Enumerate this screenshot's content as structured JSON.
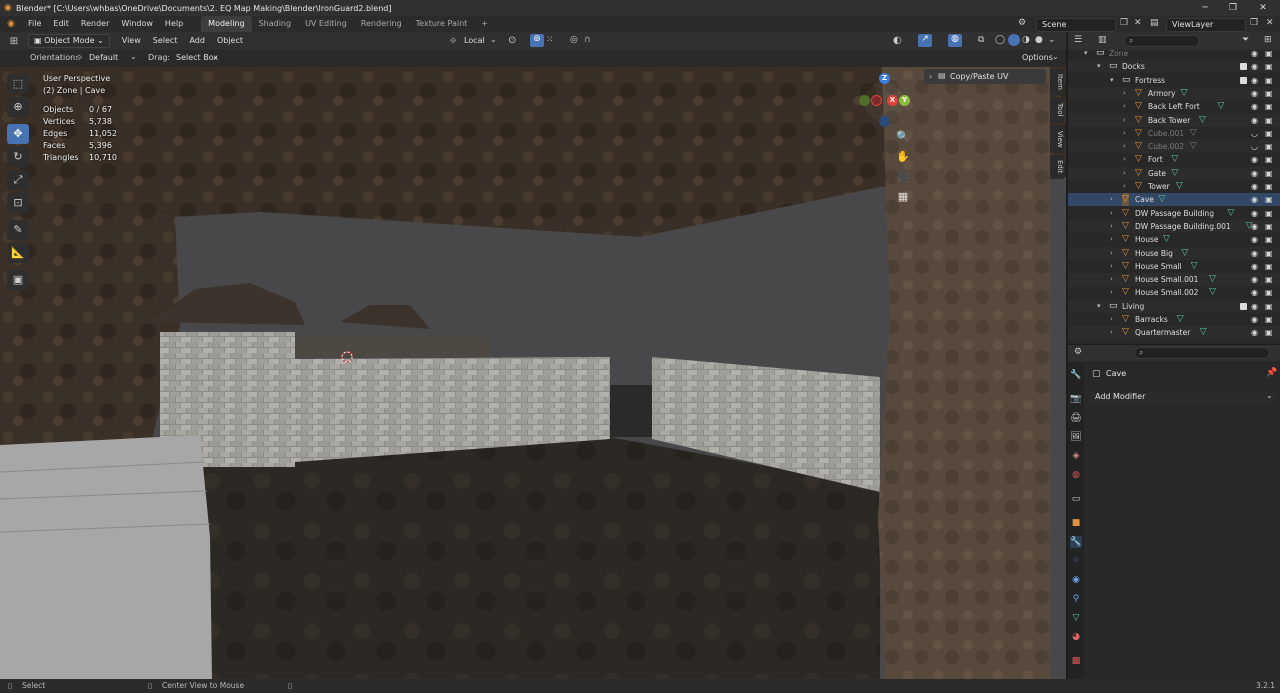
{
  "window": {
    "title": "Blender* [C:\\Users\\whbas\\OneDrive\\Documents\\2. EQ Map Making\\Blender\\IronGuard2.blend]",
    "min": "─",
    "max": "❐",
    "close": "✕"
  },
  "menu": [
    "File",
    "Edit",
    "Render",
    "Window",
    "Help"
  ],
  "workspaces": [
    "Modeling",
    "Shading",
    "UV Editing",
    "Rendering",
    "Texture Paint"
  ],
  "workspace_add": "+",
  "scene": {
    "label": "Scene"
  },
  "view_layer": {
    "label": "ViewLayer"
  },
  "viewport_header": {
    "mode": "Object Mode",
    "items": [
      "View",
      "Select",
      "Add",
      "Object"
    ],
    "transform_orientation": "Local"
  },
  "tool_settings": {
    "orientation_label": "Orientation:",
    "orientation_value": "Default",
    "drag_label": "Drag:",
    "drag_value": "Select Box",
    "options": "Options"
  },
  "overlay": {
    "view_name": "User Perspective",
    "collection": "(2) Zone | Cave",
    "stats": [
      {
        "label": "Objects",
        "value": "0 / 67"
      },
      {
        "label": "Vertices",
        "value": "5,738"
      },
      {
        "label": "Edges",
        "value": "11,052"
      },
      {
        "label": "Faces",
        "value": "5,396"
      },
      {
        "label": "Triangles",
        "value": "10,710"
      }
    ]
  },
  "gizmo": {
    "x": "X",
    "y": "Y",
    "z": "Z"
  },
  "npanel": {
    "tabs": [
      "Item",
      "Tool",
      "View",
      "Edit"
    ],
    "panel_title": "Copy/Paste UV"
  },
  "outliner": {
    "rows": [
      {
        "label": "Zone",
        "indent": 0,
        "icon": "collection",
        "dim": true
      },
      {
        "label": "Docks",
        "indent": 1,
        "icon": "collection"
      },
      {
        "label": "Fortress",
        "indent": 2,
        "icon": "collection"
      },
      {
        "label": "Armory",
        "indent": 3,
        "icon": "object"
      },
      {
        "label": "Back Left Fort",
        "indent": 3,
        "icon": "object"
      },
      {
        "label": "Back Tower",
        "indent": 3,
        "icon": "object"
      },
      {
        "label": "Cube.001",
        "indent": 3,
        "icon": "object",
        "dim": true
      },
      {
        "label": "Cube.002",
        "indent": 3,
        "icon": "object",
        "dim": true
      },
      {
        "label": "Fort",
        "indent": 3,
        "icon": "object"
      },
      {
        "label": "Gate",
        "indent": 3,
        "icon": "object"
      },
      {
        "label": "Tower",
        "indent": 3,
        "icon": "object"
      },
      {
        "label": "Cave",
        "indent": 2,
        "icon": "object",
        "active": true
      },
      {
        "label": "DW Passage Building",
        "indent": 2,
        "icon": "object"
      },
      {
        "label": "DW Passage Building.001",
        "indent": 2,
        "icon": "object"
      },
      {
        "label": "House",
        "indent": 2,
        "icon": "object"
      },
      {
        "label": "House Big",
        "indent": 2,
        "icon": "object"
      },
      {
        "label": "House Small",
        "indent": 2,
        "icon": "object"
      },
      {
        "label": "House Small.001",
        "indent": 2,
        "icon": "object"
      },
      {
        "label": "House Small.002",
        "indent": 2,
        "icon": "object"
      },
      {
        "label": "Living",
        "indent": 1,
        "icon": "collection"
      },
      {
        "label": "Barracks",
        "indent": 2,
        "icon": "object"
      },
      {
        "label": "Quartermaster",
        "indent": 2,
        "icon": "object"
      }
    ]
  },
  "properties": {
    "object_name": "Cave",
    "add_modifier": "Add Modifier"
  },
  "statusbar": {
    "select": "Select",
    "center": "Center View to Mouse",
    "version": "3.2.1"
  },
  "colors": {
    "accent": "#4772b3",
    "x_axis": "#e4413a",
    "y_axis": "#8dbb3a",
    "z_axis": "#3d7ddb",
    "object_icon": "#e3923d",
    "mesh_data": "#5ac8a0"
  }
}
